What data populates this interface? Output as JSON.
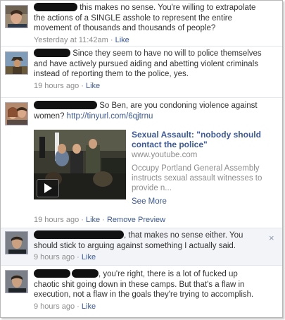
{
  "comments": [
    {
      "text": " this makes no sense. You're willing to extrapolate the actions of a SINGLE asshole to represent the entire movement of thousands and thousands of people?",
      "time": "Yesterday at 11:42am",
      "sep": " · ",
      "like": "Like"
    },
    {
      "text": " Since they seem to have no will to police themselves and have actively pursued aiding and abetting violent criminals instead of reporting them to the police, yes.",
      "time": "19 hours ago",
      "sep": " · ",
      "like": "Like"
    },
    {
      "text": " So Ben, are you condoning violence against women? ",
      "link": "http://tinyurl.com/6qjtrnu",
      "time": "19 hours ago",
      "sep": " · ",
      "like": "Like",
      "sep2": " · ",
      "remove": "Remove Preview",
      "preview": {
        "title": "Sexual Assault: \"nobody should contact the police\"",
        "domain": "www.youtube.com",
        "description": "Occupy Portland General Assembly instructs sexual assault witnesses to provide n...",
        "see_more": "See More"
      }
    },
    {
      "text": ", that makes no sense either. You should stick to arguing against something I actually said.",
      "time": "9 hours ago",
      "sep": " · ",
      "like": "Like",
      "close": "×"
    },
    {
      "text": ", you're right, there is a lot of fucked up chaotic shit going down in these camps. But that's a flaw in execution, not a flaw in the goals they're trying to accomplish.",
      "time": "9 hours ago",
      "sep": " · ",
      "like": "Like"
    }
  ],
  "colors": {
    "link": "#3b5998",
    "meta": "#8d8d8d",
    "text": "#333333"
  },
  "icons": [
    "play-icon",
    "close-icon"
  ]
}
